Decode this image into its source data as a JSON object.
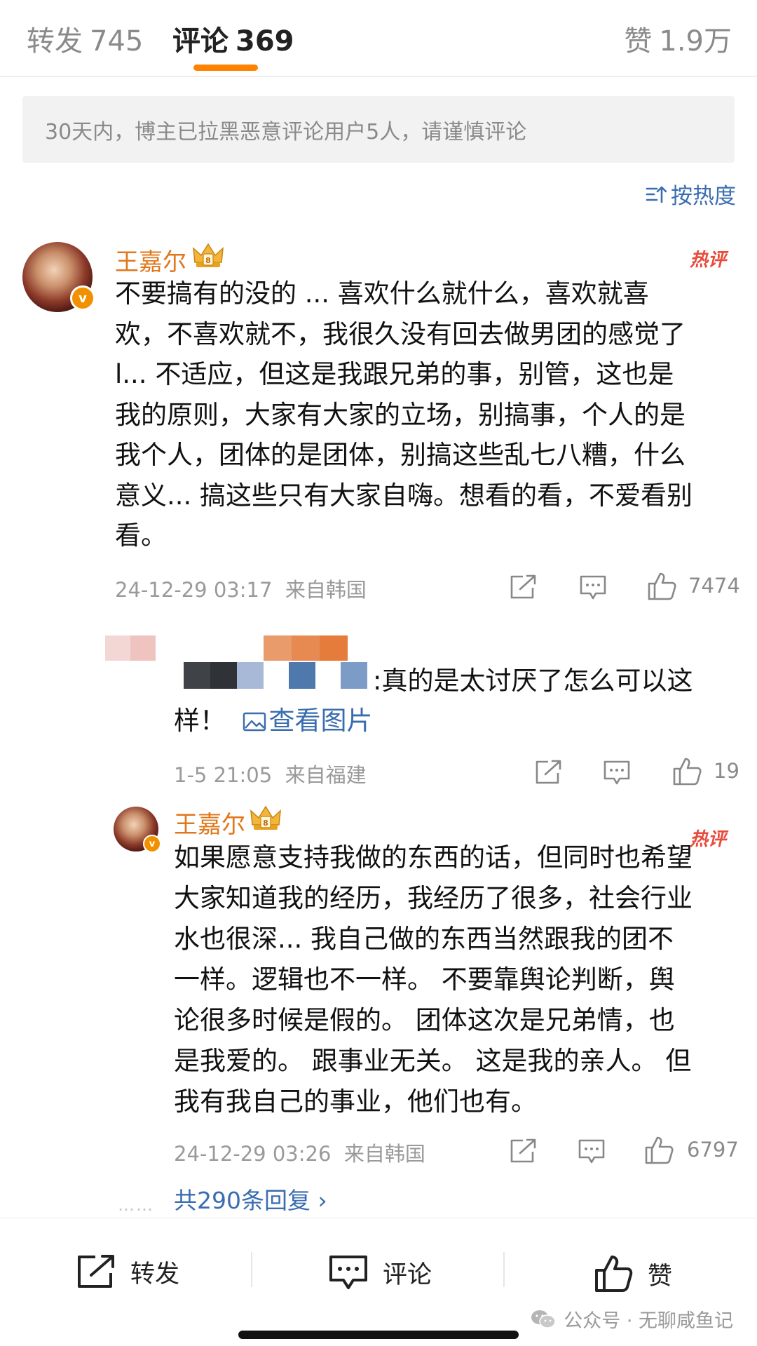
{
  "tabs": {
    "repost": {
      "label": "转发",
      "count": "745"
    },
    "comment": {
      "label": "评论",
      "count": "369"
    },
    "likes": {
      "label": "赞",
      "count": "1.9万"
    }
  },
  "notice": "30天内，博主已拉黑恶意评论用户5人，请谨慎评论",
  "sort_label": "按热度",
  "comments": [
    {
      "username": "王嘉尔",
      "hot_tag": "热评",
      "lines": [
        "不要搞有的没的 ... 喜欢什么就什么，喜欢就喜",
        "欢，不喜欢就不，我很久没有回去做男团的感觉了",
        "l... 不适应，但这是我跟兄弟的事，别管，这也是",
        "我的原则，大家有大家的立场，别搞事，个人的是",
        "我个人，团体的是团体，别搞这些乱七八糟，什么",
        "意义... 搞这些只有大家自嗨。想看的看，不爱看别",
        "看。"
      ],
      "time": "24-12-29 03:17",
      "location": "来自韩国",
      "likes": "7474"
    }
  ],
  "reply": {
    "text_line1": ":真的是太讨厌了怎么可以这",
    "text_line2": "样！",
    "view_image": "查看图片",
    "time": "1-5 21:05",
    "location": "来自福建",
    "likes": "19"
  },
  "nested_reply": {
    "username": "王嘉尔",
    "hot_tag": "热评",
    "lines": [
      "如果愿意支持我做的东西的话，但同时也希望",
      "大家知道我的经历，我经历了很多，社会行业",
      "水也很深... 我自己做的东西当然跟我的团不",
      "一样。逻辑也不一样。 不要靠舆论判断，舆",
      "论很多时候是假的。 团体这次是兄弟情，也",
      "是我爱的。 跟事业无关。 这是我的亲人。 但",
      "我有我自己的事业，他们也有。"
    ],
    "time": "24-12-29 03:26",
    "location": "来自韩国",
    "likes": "6797"
  },
  "more_replies": {
    "dots": "……",
    "label": "共290条回复 ›"
  },
  "bottom_bar": {
    "repost": "转发",
    "comment": "评论",
    "like": "赞"
  },
  "watermark": "公众号 · 无聊咸鱼记",
  "colors": {
    "accent": "#ff8200",
    "username": "#e0781b",
    "link": "#3a6db0",
    "hot": "#e84b3c",
    "verified": "#f29100"
  }
}
